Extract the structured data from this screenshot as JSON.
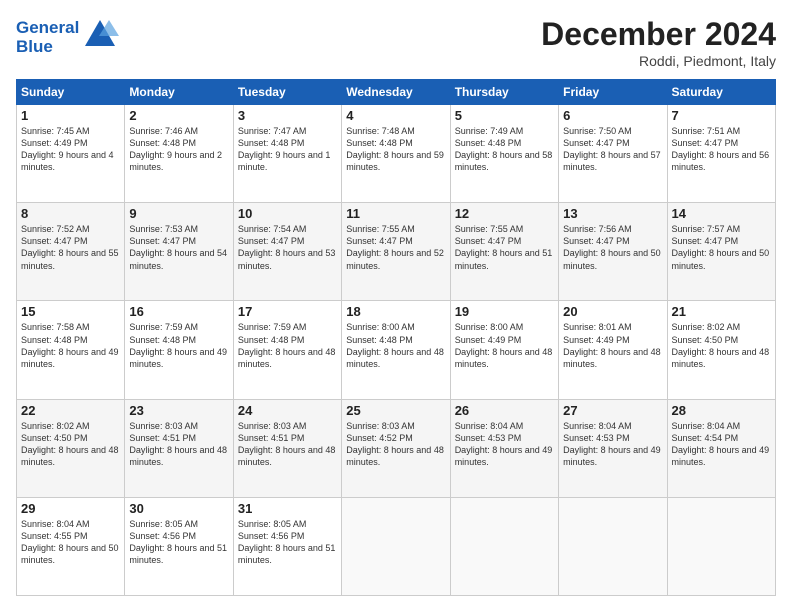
{
  "logo": {
    "line1": "General",
    "line2": "Blue"
  },
  "title": "December 2024",
  "location": "Roddi, Piedmont, Italy",
  "days_of_week": [
    "Sunday",
    "Monday",
    "Tuesday",
    "Wednesday",
    "Thursday",
    "Friday",
    "Saturday"
  ],
  "weeks": [
    [
      {
        "day": "1",
        "sunrise": "7:45 AM",
        "sunset": "4:49 PM",
        "daylight": "9 hours and 4 minutes."
      },
      {
        "day": "2",
        "sunrise": "7:46 AM",
        "sunset": "4:48 PM",
        "daylight": "9 hours and 2 minutes."
      },
      {
        "day": "3",
        "sunrise": "7:47 AM",
        "sunset": "4:48 PM",
        "daylight": "9 hours and 1 minute."
      },
      {
        "day": "4",
        "sunrise": "7:48 AM",
        "sunset": "4:48 PM",
        "daylight": "8 hours and 59 minutes."
      },
      {
        "day": "5",
        "sunrise": "7:49 AM",
        "sunset": "4:48 PM",
        "daylight": "8 hours and 58 minutes."
      },
      {
        "day": "6",
        "sunrise": "7:50 AM",
        "sunset": "4:47 PM",
        "daylight": "8 hours and 57 minutes."
      },
      {
        "day": "7",
        "sunrise": "7:51 AM",
        "sunset": "4:47 PM",
        "daylight": "8 hours and 56 minutes."
      }
    ],
    [
      {
        "day": "8",
        "sunrise": "7:52 AM",
        "sunset": "4:47 PM",
        "daylight": "8 hours and 55 minutes."
      },
      {
        "day": "9",
        "sunrise": "7:53 AM",
        "sunset": "4:47 PM",
        "daylight": "8 hours and 54 minutes."
      },
      {
        "day": "10",
        "sunrise": "7:54 AM",
        "sunset": "4:47 PM",
        "daylight": "8 hours and 53 minutes."
      },
      {
        "day": "11",
        "sunrise": "7:55 AM",
        "sunset": "4:47 PM",
        "daylight": "8 hours and 52 minutes."
      },
      {
        "day": "12",
        "sunrise": "7:55 AM",
        "sunset": "4:47 PM",
        "daylight": "8 hours and 51 minutes."
      },
      {
        "day": "13",
        "sunrise": "7:56 AM",
        "sunset": "4:47 PM",
        "daylight": "8 hours and 50 minutes."
      },
      {
        "day": "14",
        "sunrise": "7:57 AM",
        "sunset": "4:47 PM",
        "daylight": "8 hours and 50 minutes."
      }
    ],
    [
      {
        "day": "15",
        "sunrise": "7:58 AM",
        "sunset": "4:48 PM",
        "daylight": "8 hours and 49 minutes."
      },
      {
        "day": "16",
        "sunrise": "7:59 AM",
        "sunset": "4:48 PM",
        "daylight": "8 hours and 49 minutes."
      },
      {
        "day": "17",
        "sunrise": "7:59 AM",
        "sunset": "4:48 PM",
        "daylight": "8 hours and 48 minutes."
      },
      {
        "day": "18",
        "sunrise": "8:00 AM",
        "sunset": "4:48 PM",
        "daylight": "8 hours and 48 minutes."
      },
      {
        "day": "19",
        "sunrise": "8:00 AM",
        "sunset": "4:49 PM",
        "daylight": "8 hours and 48 minutes."
      },
      {
        "day": "20",
        "sunrise": "8:01 AM",
        "sunset": "4:49 PM",
        "daylight": "8 hours and 48 minutes."
      },
      {
        "day": "21",
        "sunrise": "8:02 AM",
        "sunset": "4:50 PM",
        "daylight": "8 hours and 48 minutes."
      }
    ],
    [
      {
        "day": "22",
        "sunrise": "8:02 AM",
        "sunset": "4:50 PM",
        "daylight": "8 hours and 48 minutes."
      },
      {
        "day": "23",
        "sunrise": "8:03 AM",
        "sunset": "4:51 PM",
        "daylight": "8 hours and 48 minutes."
      },
      {
        "day": "24",
        "sunrise": "8:03 AM",
        "sunset": "4:51 PM",
        "daylight": "8 hours and 48 minutes."
      },
      {
        "day": "25",
        "sunrise": "8:03 AM",
        "sunset": "4:52 PM",
        "daylight": "8 hours and 48 minutes."
      },
      {
        "day": "26",
        "sunrise": "8:04 AM",
        "sunset": "4:53 PM",
        "daylight": "8 hours and 49 minutes."
      },
      {
        "day": "27",
        "sunrise": "8:04 AM",
        "sunset": "4:53 PM",
        "daylight": "8 hours and 49 minutes."
      },
      {
        "day": "28",
        "sunrise": "8:04 AM",
        "sunset": "4:54 PM",
        "daylight": "8 hours and 49 minutes."
      }
    ],
    [
      {
        "day": "29",
        "sunrise": "8:04 AM",
        "sunset": "4:55 PM",
        "daylight": "8 hours and 50 minutes."
      },
      {
        "day": "30",
        "sunrise": "8:05 AM",
        "sunset": "4:56 PM",
        "daylight": "8 hours and 51 minutes."
      },
      {
        "day": "31",
        "sunrise": "8:05 AM",
        "sunset": "4:56 PM",
        "daylight": "8 hours and 51 minutes."
      },
      null,
      null,
      null,
      null
    ]
  ]
}
